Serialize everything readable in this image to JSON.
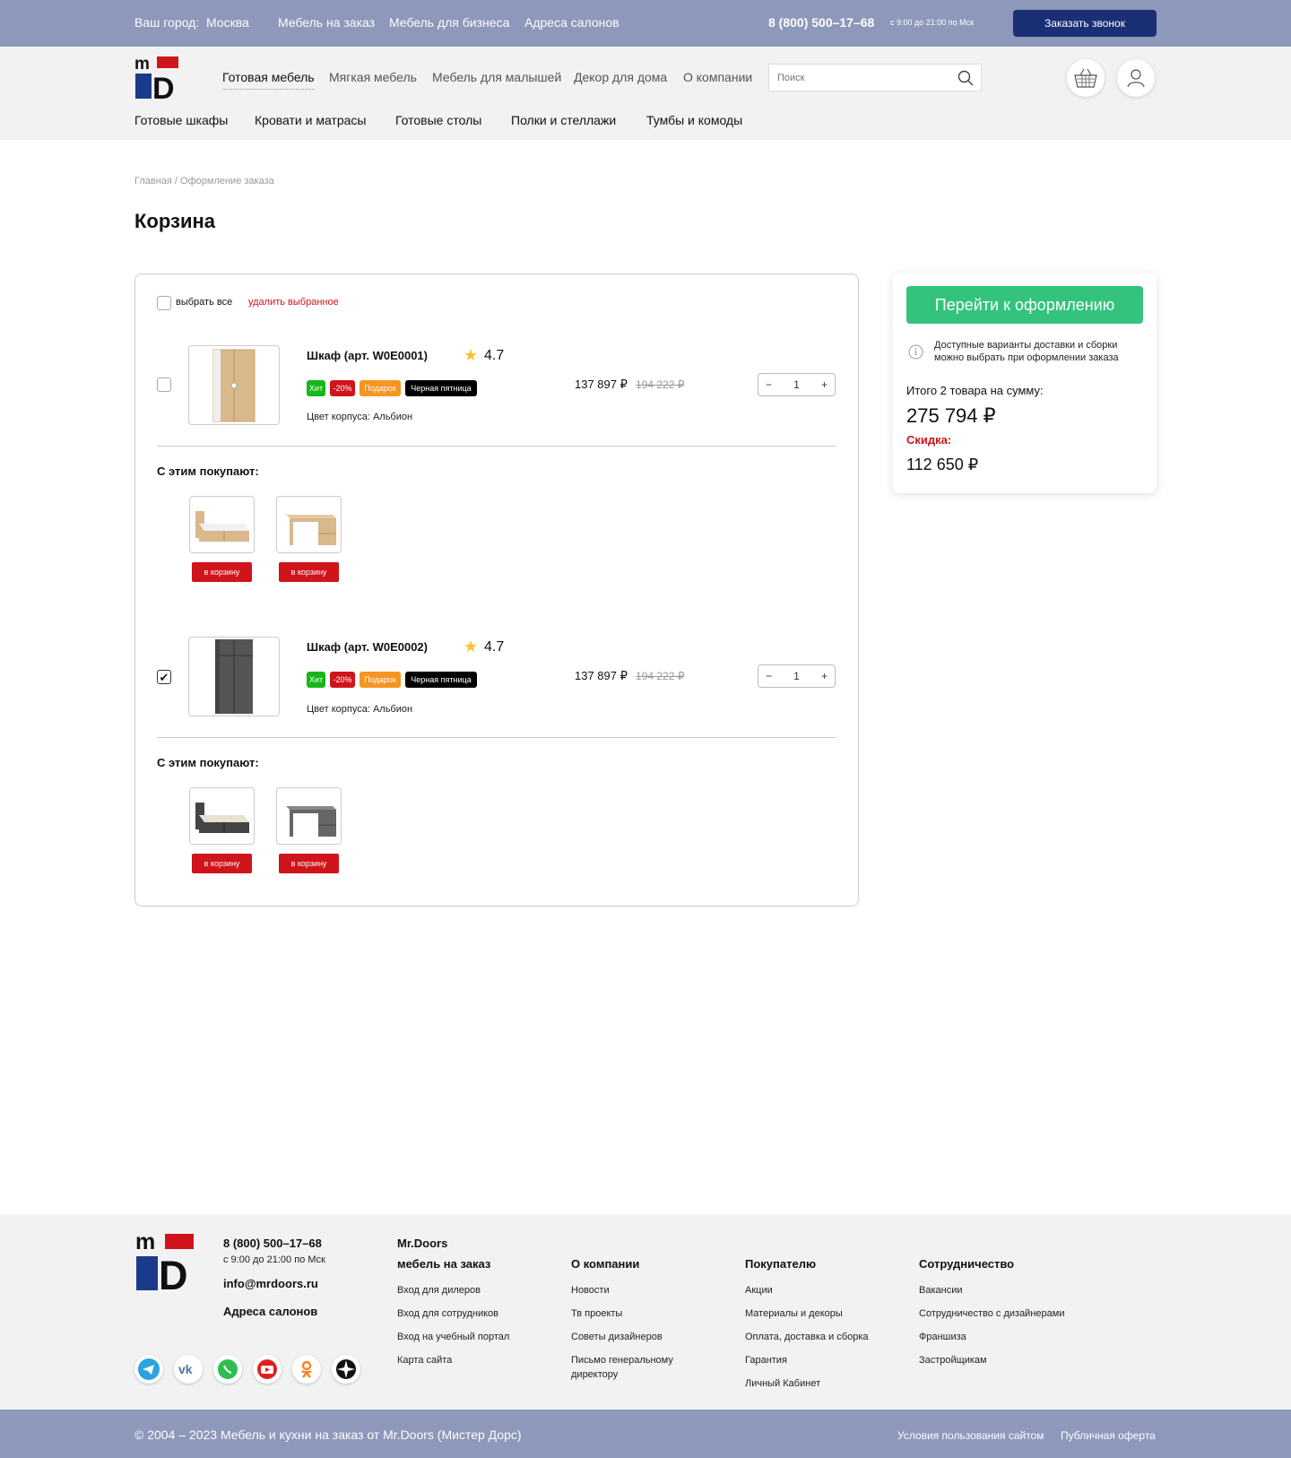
{
  "topbar": {
    "city_label": "Ваш город:",
    "city": "Москва",
    "links": [
      "Мебель на заказ",
      "Мебель для бизнеса",
      "Адреса салонов"
    ],
    "phone": "8 (800) 500–17–68",
    "hours": "с 9:00 до 21:00 по Мск",
    "call_button": "Заказать звонок"
  },
  "header": {
    "nav": [
      "Готовая мебель",
      "Мягкая мебель",
      "Мебель для малышей",
      "Декор для дома",
      "О компании"
    ],
    "search_placeholder": "Поиск",
    "subnav": [
      "Готовые шкафы",
      "Кровати и матрасы",
      "Готовые столы",
      "Полки и стеллажи",
      "Тумбы и комоды"
    ]
  },
  "breadcrumb": "Главная / Оформление заказа",
  "page_title": "Корзина",
  "cart": {
    "select_all": "выбрать все",
    "delete_selected": "удалить выбранное",
    "items": [
      {
        "name": "Шкаф (арт. W0E0001)",
        "rating": "4.7",
        "badges": [
          "Хит",
          "-20%",
          "Подарок",
          "Черная пятница"
        ],
        "price": "137 897 ₽",
        "old_price": "194 222 ₽",
        "color": "Цвет корпуса: Альбион",
        "qty": "1",
        "checked": false,
        "also_title": "С этим покупают:",
        "also_button": "в корзину"
      },
      {
        "name": "Шкаф (арт. W0E0002)",
        "rating": "4.7",
        "badges": [
          "Хит",
          "-20%",
          "Подарок",
          "Черная пятница"
        ],
        "price": "137 897 ₽",
        "old_price": "194 222 ₽",
        "color": "Цвет корпуса: Альбион",
        "qty": "1",
        "checked": true,
        "also_title": "С этим покупают:",
        "also_button": "в корзину"
      }
    ]
  },
  "summary": {
    "checkout_button": "Перейти к оформлению",
    "note_line1": "Доступные варианты доставки и сборки",
    "note_line2": "можно выбрать при оформлении заказа",
    "total_label": "Итого 2 товара на сумму:",
    "total": "275 794 ₽",
    "discount_label": "Скидка:",
    "discount": "112 650 ₽"
  },
  "footer": {
    "phone": "8 (800) 500–17–68",
    "hours": "с 9:00 до 21:00 по Мск",
    "email": "info@mrdoors.ru",
    "salons": "Адреса салонов",
    "brand": "Mr.Doors",
    "columns": [
      {
        "title": "мебель на заказ",
        "links": [
          "Вход для дилеров",
          "Вход для сотрудников",
          "Вход на учебный портал",
          "Карта сайта"
        ]
      },
      {
        "title": "О компании",
        "links": [
          "Новости",
          "Тв проекты",
          "Советы дизайнеров",
          "Письмо генеральному",
          "директору"
        ]
      },
      {
        "title": "Покупателю",
        "links": [
          "Акции",
          "Материалы и декоры",
          "Оплата, доставка и сборка",
          "Гарантия",
          "Личный Кабинет"
        ]
      },
      {
        "title": "Сотрудничество",
        "links": [
          "Вакансии",
          "Сотрудничество с дизайнерами",
          "Франшиза",
          "Застройщикам"
        ]
      }
    ],
    "socials": [
      "telegram-icon",
      "vk-icon",
      "whatsapp-icon",
      "youtube-icon",
      "odnoklassniki-icon",
      "other-icon"
    ]
  },
  "bottombar": {
    "copyright": "© 2004 – 2023 Мебель и кухни на заказ от Mr.Doors (Мистер Дорс)",
    "terms": "Условия пользования сайтом",
    "offer": "Публичная оферта"
  },
  "colors": {
    "topbar": "#8d98ba",
    "call_button": "#1b2f77",
    "accent_red": "#d0141b",
    "checkout_green": "#33c37d",
    "badge_hit": "#17b61c",
    "badge_gift": "#f59522",
    "badge_black": "#000000"
  }
}
